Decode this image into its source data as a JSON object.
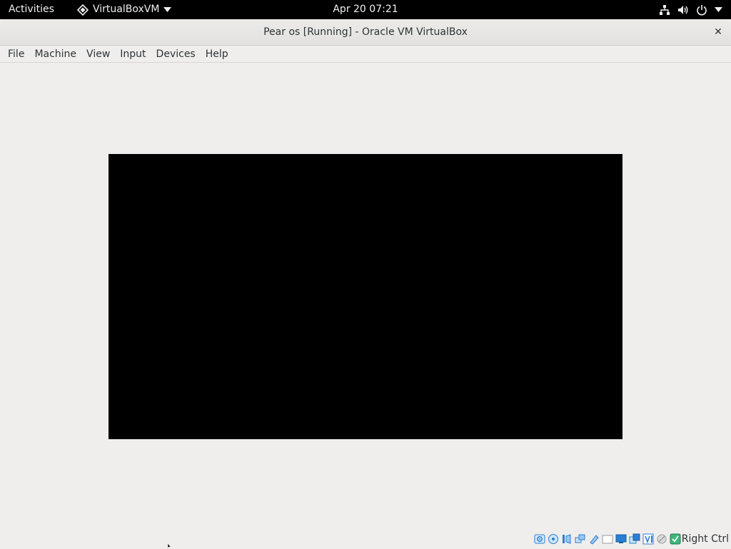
{
  "topbar": {
    "activities": "Activities",
    "app_name": "VirtualBoxVM",
    "clock": "Apr 20  07:21"
  },
  "window": {
    "title": "Pear os [Running] - Oracle VM VirtualBox",
    "close_glyph": "✕"
  },
  "menubar": {
    "items": [
      "File",
      "Machine",
      "View",
      "Input",
      "Devices",
      "Help"
    ]
  },
  "statusbar": {
    "icons": [
      "hard-disk-icon",
      "optical-drive-icon",
      "audio-icon",
      "network-icon",
      "usb-icon",
      "shared-folders-icon",
      "display-icon",
      "video-capture-icon",
      "vt-x-icon",
      "mouse-integration-icon",
      "keyboard-icon"
    ],
    "host_key": "Right Ctrl"
  },
  "colors": {
    "topbar_bg": "#000000",
    "window_bg": "#efeeed",
    "vm_screen_bg": "#000000",
    "status_icon_blue": "#2a7fd4"
  }
}
